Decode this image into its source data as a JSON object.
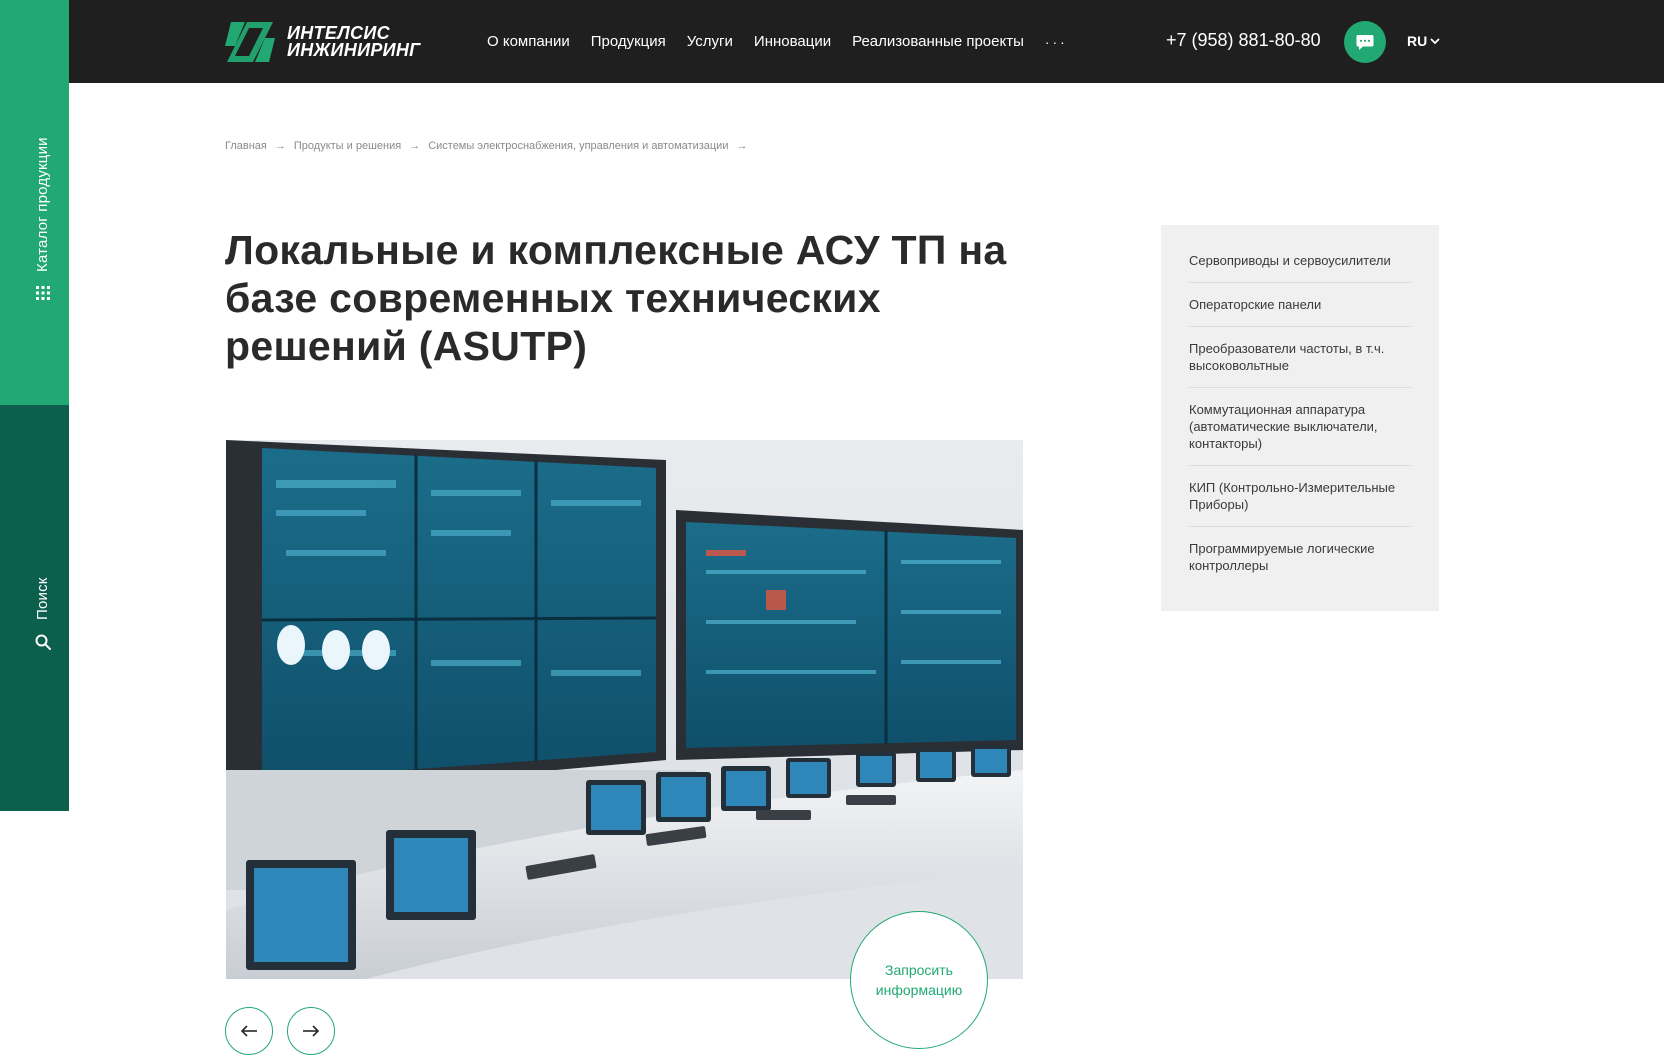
{
  "rail": {
    "catalog_label": "Каталог продукции",
    "search_label": "Поиск"
  },
  "header": {
    "logo_line1": "ИНТЕЛСИС",
    "logo_line2": "ИНЖИНИРИНГ",
    "nav": [
      "О компании",
      "Продукция",
      "Услуги",
      "Инновации",
      "Реализованные проекты"
    ],
    "more": "···",
    "phone": "+7 (958) 881-80-80",
    "lang": "RU"
  },
  "breadcrumb": {
    "items": [
      "Главная",
      "Продукты и решения",
      "Системы электроснабжения, управления и автоматизации"
    ],
    "separator": "→"
  },
  "title": "Локальные и комплексные АСУ ТП на базе современных технических решений (ASUTP)",
  "hero": {
    "request_line1": "Запросить",
    "request_line2": "информацию"
  },
  "sidebar": {
    "items": [
      "Сервоприводы и сервоусилители",
      "Операторские панели",
      "Преобразователи частоты, в т.ч. высоковольтные",
      "Коммутационная аппаратура (автоматические выключатели, контакторы)",
      "КИП (Контрольно-Измерительные Приборы)",
      "Программируемые логические контроллеры"
    ]
  },
  "colors": {
    "brand_green": "#22a873",
    "dark_green": "#0d5f4d",
    "header_bg": "#1f1f1f"
  }
}
